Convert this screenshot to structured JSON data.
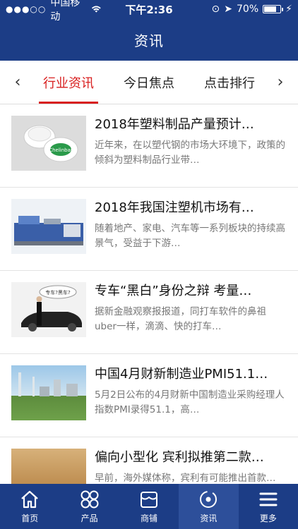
{
  "status": {
    "carrier": "中国移动",
    "time": "下午2:36",
    "battery": "70%",
    "battery_level": 0.7
  },
  "header": {
    "title": "资讯"
  },
  "tabs": {
    "prev": "‹",
    "next": "›",
    "items": [
      "行业资讯",
      "今日焦点",
      "点击排行"
    ]
  },
  "news": [
    {
      "title": "2018年塑料制品产量预计…",
      "summary": "近年来，在以塑代钢的市场大环境下，政策的倾斜为塑料制品行业带…"
    },
    {
      "title": "2018年我国注塑机市场有…",
      "summary": "随着地产、家电、汽车等一系列板块的持续高景气，受益于下游…"
    },
    {
      "title": "专车“黑白”身份之辩 考量…",
      "summary": "据新金融观察报报道，同打车软件的鼻祖uber一样，滴滴、快的打车…",
      "thumb_caption": "专车?黑车?"
    },
    {
      "title": "中国4月财新制造业PMI51.1…",
      "summary": "5月2日公布的4月财新中国制造业采购经理人指数PMI录得51.1，高…"
    },
    {
      "title": "偏向小型化 宾利拟推第二款…",
      "summary": "早前，海外媒体称，宾利有可能推出首款…"
    }
  ],
  "thumb_logo": "Chelinbar",
  "bottom_nav": [
    "首页",
    "产品",
    "商铺",
    "资讯",
    "更多"
  ]
}
